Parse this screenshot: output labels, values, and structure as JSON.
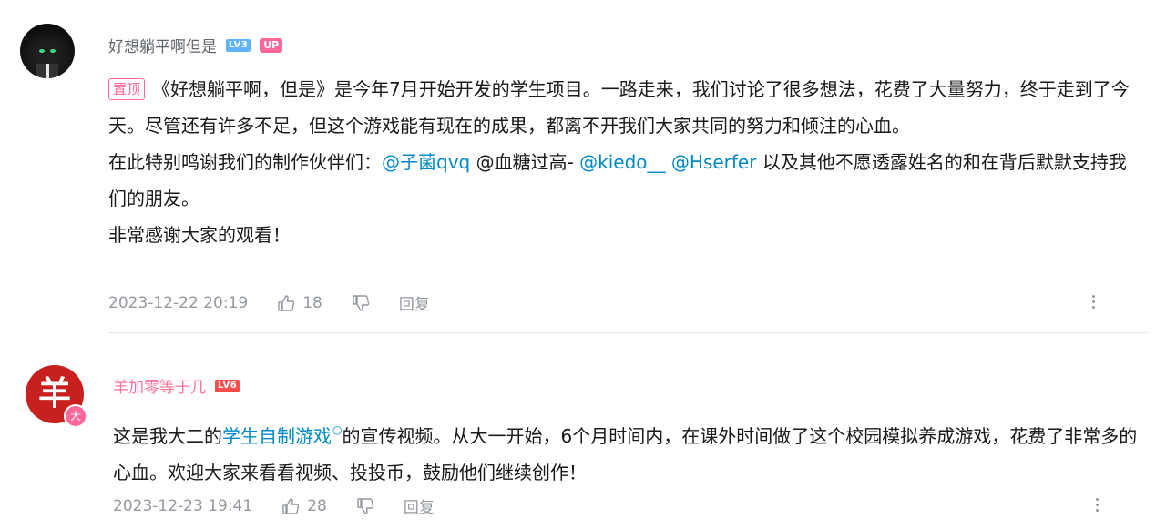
{
  "comments": [
    {
      "username": "好想躺平啊但是",
      "level": "LV3",
      "up_badge": "UP",
      "pinned_label": "置顶",
      "paragraphs": {
        "p1": "《好想躺平啊，但是》是今年7月开始开发的学生项目。一路走来，我们讨论了很多想法，花费了大量努力，终于走到了今天。尽管还有许多不足，但这个游戏能有现在的成果，都离不开我们大家共同的努力和倾注的心血。",
        "p2_prefix": "在此特别鸣谢我们的制作伙伴们：",
        "p2_m1": "@子菌qvq",
        "p2_t1": " @血糖过高- ",
        "p2_m2": "@kiedo__",
        "p2_t2": " ",
        "p2_m3": "@Hserfer",
        "p2_suffix": " 以及其他不愿透露姓名的和在背后默默支持我们的朋友。",
        "p3": "非常感谢大家的观看！"
      },
      "time": "2023-12-22 20:19",
      "likes": "18",
      "reply_label": "回复"
    },
    {
      "username": "羊加零等于几",
      "level": "LV6",
      "avatar_char": "羊",
      "avatar_badge": "大",
      "content_prefix": "这是我大二的",
      "content_link": "学生自制游戏",
      "content_suffix": "的宣传视频。从大一开始，6个月时间内，在课外时间做了这个校园模拟养成游戏，花费了非常多的心血。欢迎大家来看看视频、投投币，鼓励他们继续创作！",
      "time": "2023-12-23 19:41",
      "likes": "28",
      "reply_label": "回复"
    }
  ],
  "icons": {
    "like": "thumbs-up-icon",
    "dislike": "thumbs-down-icon",
    "more": "more-vertical-icon",
    "link": "search-link-icon"
  },
  "colors": {
    "accent_pink": "#fb7299",
    "mention_blue": "#008ac5",
    "meta_gray": "#9499a0"
  }
}
